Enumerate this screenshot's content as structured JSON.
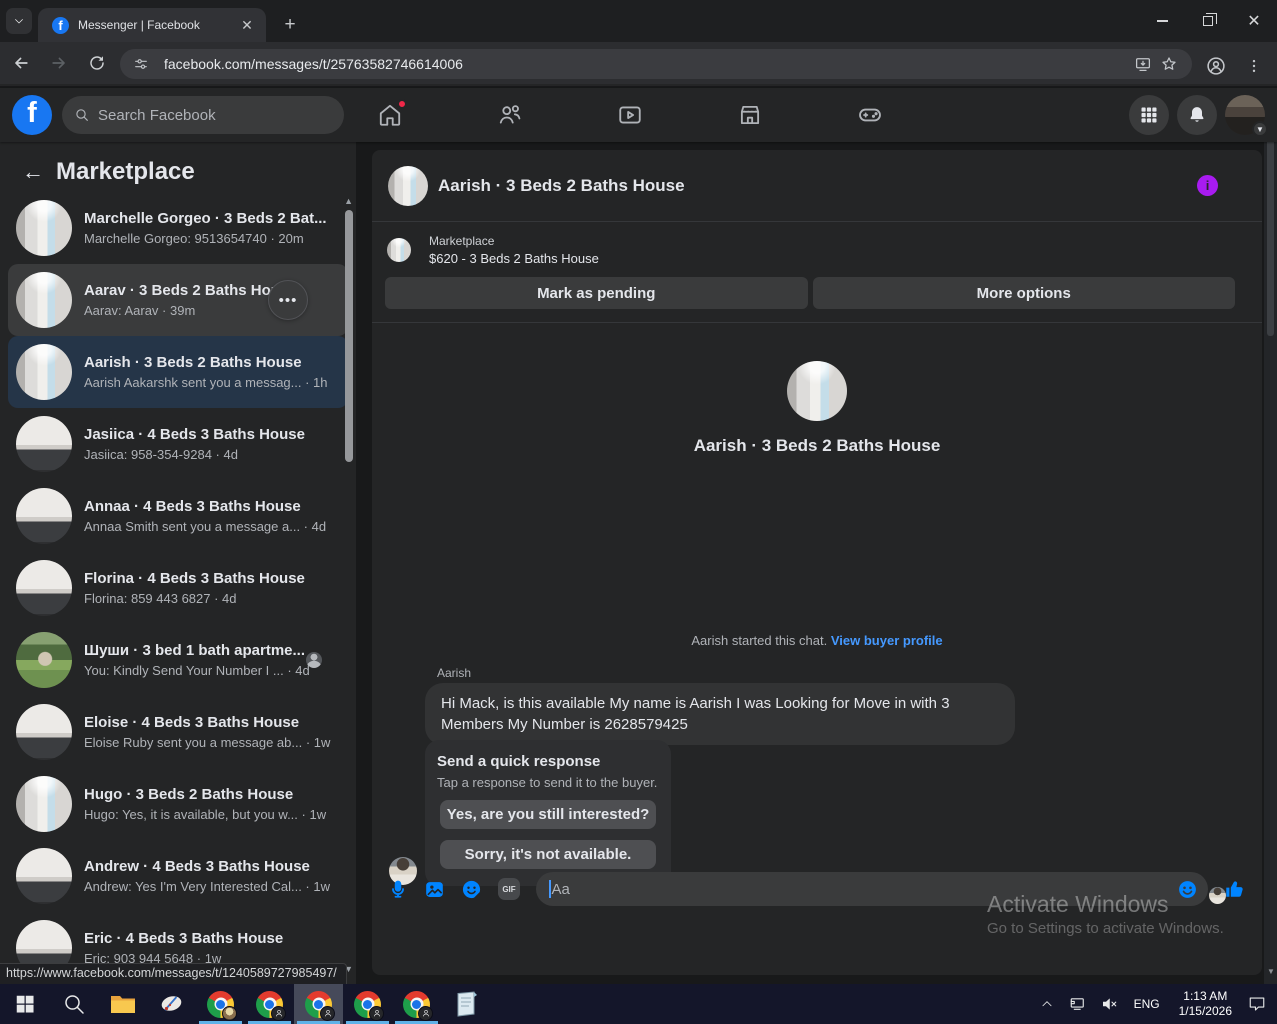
{
  "browser": {
    "tab_title": "Messenger | Facebook",
    "url": "facebook.com/messages/t/25763582746614006",
    "status_url": "https://www.facebook.com/messages/t/1240589727985497/"
  },
  "fb_header": {
    "search_placeholder": "Search Facebook"
  },
  "sidebar": {
    "title": "Marketplace",
    "conversations": [
      {
        "name": "Marchelle Gorgeo · 3 Beds 2 Bat...",
        "preview": "Marchelle Gorgeo: 9513654740",
        "time": "20m",
        "avatar": "bathroom",
        "state": "normal"
      },
      {
        "name": "Aarav · 3 Beds 2 Baths House",
        "preview": "Aarav: Aarav",
        "time": "39m",
        "avatar": "bathroom",
        "state": "hovered",
        "menu": true
      },
      {
        "name": "Aarish · 3 Beds 2 Baths House",
        "preview": "Aarish Aakarshk sent you a messag...",
        "time": "1h",
        "avatar": "bathroom",
        "state": "selected"
      },
      {
        "name": "Jasiica · 4 Beds 3 Baths House",
        "preview": "Jasiica: 958-354-9284",
        "time": "4d",
        "avatar": "kitchen",
        "state": "normal"
      },
      {
        "name": "Annaa · 4 Beds 3 Baths House",
        "preview": "Annaa Smith sent you a message a...",
        "time": "4d",
        "avatar": "kitchen",
        "state": "normal"
      },
      {
        "name": "Florina · 4 Beds 3 Baths House",
        "preview": "Florina: 859 443 6827",
        "time": "4d",
        "avatar": "kitchen",
        "state": "normal"
      },
      {
        "name": "Шуши · 3 bed 1 bath apartme...",
        "preview": "You: Kindly Send Your Number I ...",
        "time": "4d",
        "avatar": "yard",
        "state": "normal",
        "seen": true
      },
      {
        "name": "Eloise · 4 Beds 3 Baths House",
        "preview": "Eloise Ruby sent you a message ab...",
        "time": "1w",
        "avatar": "kitchen",
        "state": "normal"
      },
      {
        "name": "Hugo · 3 Beds 2 Baths House",
        "preview": "Hugo: Yes, it is available, but you w...",
        "time": "1w",
        "avatar": "bathroom",
        "state": "normal"
      },
      {
        "name": "Andrew · 4 Beds 3 Baths House",
        "preview": "Andrew: Yes I'm Very Interested Cal...",
        "time": "1w",
        "avatar": "kitchen",
        "state": "normal"
      },
      {
        "name": "Eric · 4 Beds 3 Baths House",
        "preview": "Eric: 903 944 5648",
        "time": "1w",
        "avatar": "kitchen",
        "state": "normal"
      }
    ]
  },
  "chat": {
    "header_title": "Aarish · 3 Beds 2 Baths House",
    "mp_label": "Marketplace",
    "listing": "$620 - 3 Beds 2 Baths House",
    "btn_pending": "Mark as pending",
    "btn_more": "More options",
    "intro_title": "Aarish · 3 Beds 2 Baths House",
    "started_text": "Aarish started this chat.",
    "link_buyer": "View buyer profile",
    "sender_name": "Aarish",
    "message": "Hi Mack, is this available My name is Aarish I was Looking for Move in with 3 Members My Number is 2628579425",
    "qr": {
      "title": "Send a quick response",
      "subtitle": "Tap a response to send it to the buyer.",
      "options": [
        "Yes, are you still interested?",
        "Sorry, it's not available."
      ]
    },
    "composer_placeholder": "Aa",
    "gif_label": "GIF"
  },
  "watermark": {
    "line1": "Activate Windows",
    "line2": "Go to Settings to activate Windows."
  },
  "taskbar": {
    "lang": "ENG",
    "time": "1:13 AM",
    "date": "1/15/2026"
  },
  "icons": {
    "tab_search": "chevron-down",
    "home": "house",
    "friends": "two-people",
    "watch": "tv-play",
    "marketplace": "storefront",
    "gaming": "game-controller",
    "apps": "grid-3x3",
    "notifications": "bell",
    "mic": "microphone",
    "image": "photo",
    "sticker": "sticker-smile",
    "gif": "gif-chip",
    "emoji": "smiley",
    "like": "thumbs-up",
    "info": "info-circle"
  },
  "colors": {
    "accent_blue": "#0084ff",
    "link_blue": "#4599ff",
    "info_purple": "#a81bf0",
    "page_bg": "#18191a",
    "card_bg": "#242526",
    "hover": "#3a3b3c",
    "selected": "#2c3b4d",
    "taskbar_underline": "#5fb2e8",
    "red_badge": "#f02849"
  }
}
